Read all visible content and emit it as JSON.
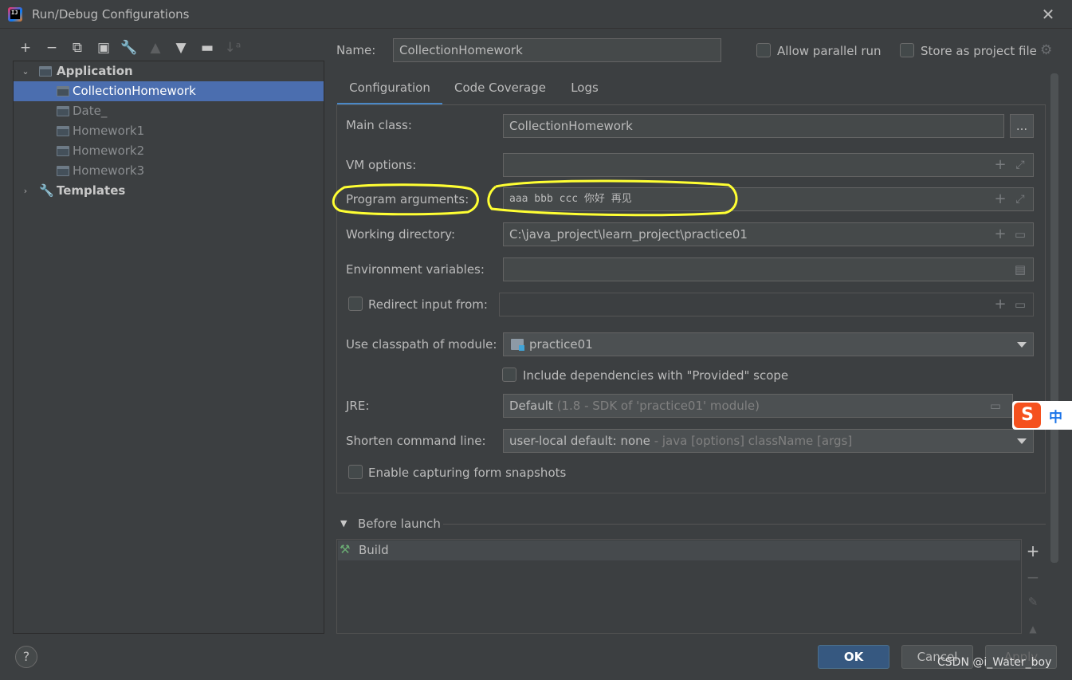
{
  "window": {
    "title": "Run/Debug Configurations",
    "close_icon": "close-icon"
  },
  "toolbar": {
    "icons": [
      "plus-icon",
      "minus-icon",
      "copy-icon",
      "save-icon",
      "wrench-icon",
      "arrow-up-icon",
      "arrow-down-icon",
      "new-folder-icon",
      "sort-alpha-icon"
    ]
  },
  "tree": {
    "application": "Application",
    "items": [
      "CollectionHomework",
      "Date_",
      "Homework1",
      "Homework2",
      "Homework3"
    ],
    "templates": "Templates"
  },
  "header": {
    "name_label": "Name:",
    "name_value": "CollectionHomework",
    "allow_parallel": "Allow parallel run",
    "store_as_project": "Store as project file"
  },
  "tabs": [
    "Configuration",
    "Code Coverage",
    "Logs"
  ],
  "form": {
    "main_class_label": "Main class:",
    "main_class_value": "CollectionHomework",
    "browse_label": "...",
    "vm_options_label": "VM options:",
    "vm_options_value": "",
    "program_args_label": "Program arguments:",
    "program_args_value": "aaa bbb ccc 你好 再见",
    "working_dir_label": "Working directory:",
    "working_dir_value": "C:\\java_project\\learn_project\\practice01",
    "env_vars_label": "Environment variables:",
    "env_vars_value": "",
    "redirect_label": "Redirect input from:",
    "redirect_value": "",
    "classpath_label": "Use classpath of module:",
    "classpath_value": "practice01",
    "include_deps_label": "Include dependencies with \"Provided\" scope",
    "jre_label": "JRE:",
    "jre_value": "Default",
    "jre_hint": "(1.8 - SDK of 'practice01' module)",
    "shorten_label": "Shorten command line:",
    "shorten_value": "user-local default: none",
    "shorten_hint": "- java [options] className [args]",
    "capture_label": "Enable capturing form snapshots"
  },
  "before_launch": {
    "title": "Before launch",
    "items": [
      "Build"
    ]
  },
  "buttons": {
    "ok": "OK",
    "cancel": "Cancel",
    "apply": "Apply",
    "help": "?"
  },
  "ime": {
    "logo": "S",
    "mode": "中"
  },
  "watermark": "CSDN @i_Water_boy",
  "colors": {
    "accent": "#4b6eaf",
    "highlight": "#ffff33",
    "background": "#3c3f41"
  }
}
